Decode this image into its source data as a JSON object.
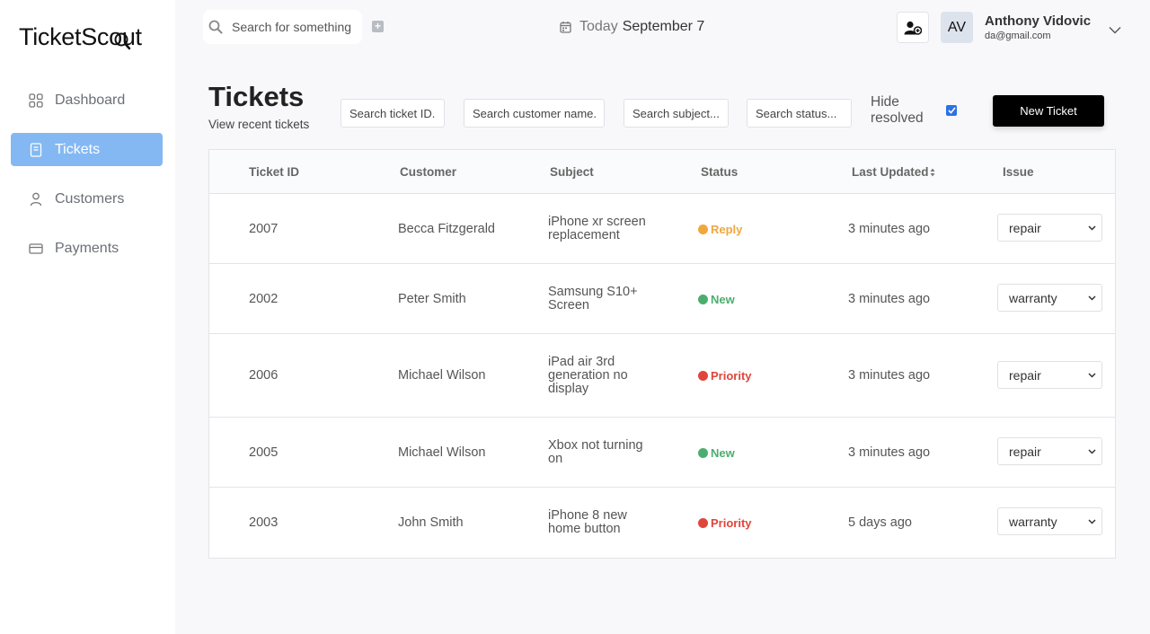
{
  "app": {
    "logo_text": "TicketScout"
  },
  "sidebar": {
    "items": [
      {
        "label": "Dashboard",
        "icon": "grid-icon",
        "active": false
      },
      {
        "label": "Tickets",
        "icon": "document-icon",
        "active": true
      },
      {
        "label": "Customers",
        "icon": "person-icon",
        "active": false
      },
      {
        "label": "Payments",
        "icon": "credit-card-icon",
        "active": false
      }
    ]
  },
  "topbar": {
    "search_placeholder": "Search for something",
    "date_prefix": "Today",
    "date_value": "September 7",
    "user": {
      "initials": "AV",
      "name": "Anthony Vidovic",
      "email": "da@gmail.com"
    }
  },
  "page": {
    "title": "Tickets",
    "subtitle": "View recent tickets",
    "filters": {
      "ticket_id_placeholder": "Search ticket ID...",
      "customer_placeholder": "Search customer name...",
      "subject_placeholder": "Search subject...",
      "status_placeholder": "Search status..."
    },
    "hide_resolved_label": "Hide resolved",
    "hide_resolved_checked": true,
    "new_ticket_label": "New Ticket"
  },
  "table": {
    "headers": {
      "ticket_id": "Ticket ID",
      "customer": "Customer",
      "subject": "Subject",
      "status": "Status",
      "last_updated": "Last Updated",
      "issue": "Issue"
    },
    "rows": [
      {
        "id": "2007",
        "customer": "Becca Fitzgerald",
        "subject": "iPhone xr screen replacement",
        "status": "Reply",
        "status_color": "#f0a73c",
        "updated": "3 minutes ago",
        "issue": "repair"
      },
      {
        "id": "2002",
        "customer": "Peter Smith",
        "subject": "Samsung S10+ Screen",
        "status": "New",
        "status_color": "#4cae6e",
        "updated": "3 minutes ago",
        "issue": "warranty"
      },
      {
        "id": "2006",
        "customer": "Michael Wilson",
        "subject": "iPad air 3rd generation no display",
        "status": "Priority",
        "status_color": "#e0453c",
        "updated": "3 minutes ago",
        "issue": "repair"
      },
      {
        "id": "2005",
        "customer": "Michael Wilson",
        "subject": "Xbox not turning on",
        "status": "New",
        "status_color": "#4cae6e",
        "updated": "3 minutes ago",
        "issue": "repair"
      },
      {
        "id": "2003",
        "customer": "John Smith",
        "subject": "iPhone 8 new home button",
        "status": "Priority",
        "status_color": "#e0453c",
        "updated": "5 days ago",
        "issue": "warranty"
      }
    ]
  },
  "colors": {
    "accent": "#84b8f3",
    "primary_button": "#000000",
    "checkbox": "#2b72e6"
  }
}
